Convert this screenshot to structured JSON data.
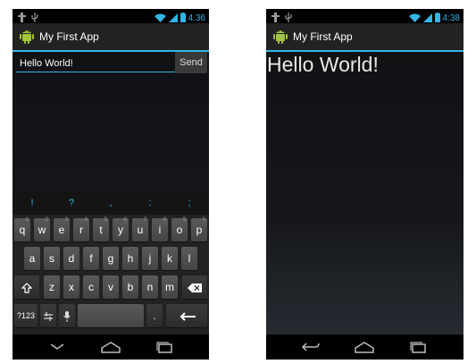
{
  "colors": {
    "accent": "#33b5e5",
    "background": "#15171b",
    "action_bar": "#222222"
  },
  "left_phone": {
    "status_time": "4:36",
    "app_title": "My First App",
    "input_value": "Hello World!",
    "send_label": "Send",
    "suggestions": [
      "!",
      "?",
      ",",
      ":",
      ";"
    ],
    "keyboard": {
      "row1": [
        "q",
        "w",
        "e",
        "r",
        "t",
        "y",
        "u",
        "i",
        "o",
        "p"
      ],
      "row1_alt": [
        "1",
        "2",
        "3",
        "4",
        "5",
        "6",
        "7",
        "8",
        "9",
        "0"
      ],
      "row2": [
        "a",
        "s",
        "d",
        "f",
        "g",
        "h",
        "j",
        "k",
        "l"
      ],
      "row3": [
        "z",
        "x",
        "c",
        "v",
        "b",
        "n",
        "m"
      ],
      "numbers_key": "?123",
      "period_key": "."
    },
    "icons": [
      "usb-icon",
      "debug-icon",
      "wifi-icon",
      "signal-icon",
      "battery-icon",
      "android-icon",
      "shift-icon",
      "backspace-icon",
      "settings-icon",
      "mic-icon",
      "enter-icon",
      "nav-back-down-icon",
      "nav-home-icon",
      "nav-recent-icon"
    ]
  },
  "right_phone": {
    "status_time": "4:38",
    "app_title": "My First App",
    "message": "Hello World!",
    "icons": [
      "usb-icon",
      "debug-icon",
      "wifi-icon",
      "signal-icon",
      "battery-icon",
      "android-icon",
      "nav-back-icon",
      "nav-home-icon",
      "nav-recent-icon"
    ]
  }
}
